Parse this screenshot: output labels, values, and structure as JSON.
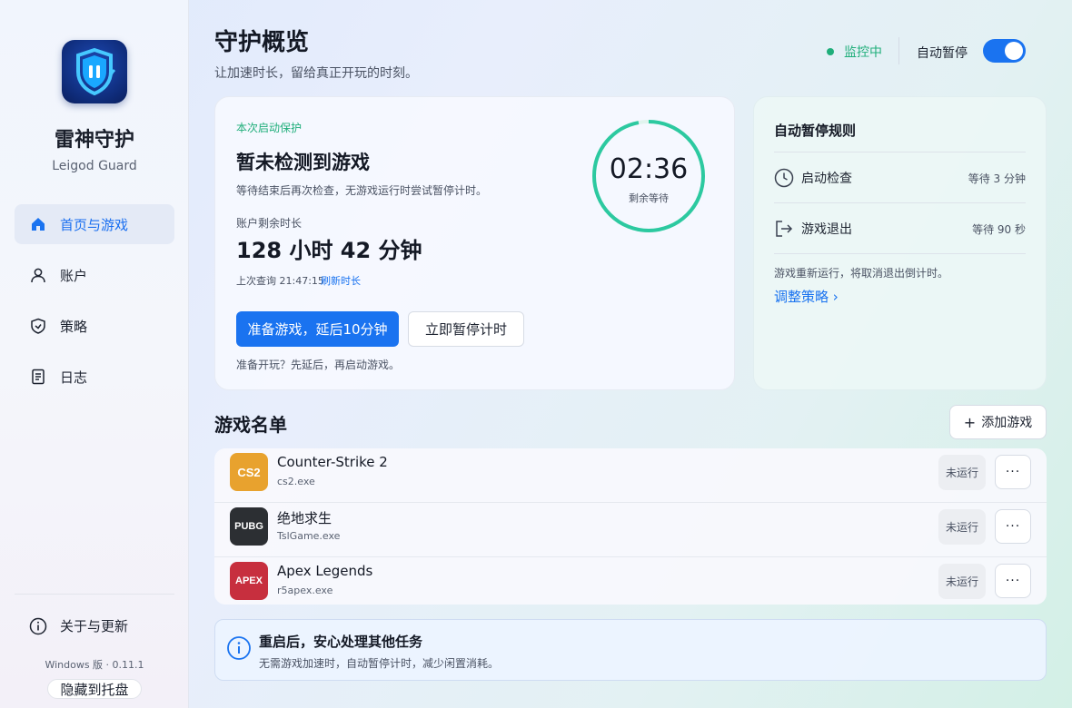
{
  "brand": {
    "name": "雷神守护",
    "sub": "Leigod Guard"
  },
  "nav": [
    {
      "label": "首页与游戏",
      "icon": "home-icon",
      "active": true
    },
    {
      "label": "账户",
      "icon": "user-icon"
    },
    {
      "label": "策略",
      "icon": "shield-icon"
    },
    {
      "label": "日志",
      "icon": "document-icon"
    }
  ],
  "sidebar_footer": {
    "about": "关于与更新",
    "version": "Windows 版 · 0.11.1",
    "tray_button": "隐藏到托盘"
  },
  "header": {
    "title": "守护概览",
    "subtitle": "让加速时长，留给真正开玩的时刻。",
    "status": "监控中",
    "auto_pause_label": "自动暂停",
    "auto_pause_on": true
  },
  "session": {
    "tag": "本次启动保护",
    "title": "暂未检测到游戏",
    "desc": "等待结束后再次检查，无游戏运行时尝试暂停计时。",
    "remaining_label": "账户剩余时长",
    "remaining_value": "128 小时 42 分钟",
    "last_query": "上次查询 21:47:15",
    "refresh": "刷新时长",
    "primary_button": "准备游戏，延后10分钟",
    "secondary_button": "立即暂停计时",
    "hint": "准备开玩？先延后，再启动游戏。",
    "timer": {
      "time": "02:36",
      "label": "剩余等待",
      "progress": 0.97
    }
  },
  "rules": {
    "title": "自动暂停规则",
    "items": [
      {
        "name": "启动检查",
        "value": "等待 3 分钟",
        "icon": "clock-icon"
      },
      {
        "name": "游戏退出",
        "value": "等待 90 秒",
        "icon": "exit-icon"
      }
    ],
    "note": "游戏重新运行，将取消退出倒计时。",
    "link": "调整策略 ›"
  },
  "games": {
    "title": "游戏名单",
    "add_button": "添加游戏",
    "items": [
      {
        "name": "Counter-Strike 2",
        "exe": "cs2.exe",
        "status": "未运行",
        "badge": "CS2",
        "color": "#e8a22e"
      },
      {
        "name": "绝地求生",
        "exe": "TslGame.exe",
        "status": "未运行",
        "badge": "PUBG",
        "color": "#2c2f33"
      },
      {
        "name": "Apex Legends",
        "exe": "r5apex.exe",
        "status": "未运行",
        "badge": "APEX",
        "color": "#c72f3e"
      }
    ],
    "more_label": "···"
  },
  "info": {
    "title": "重启后，安心处理其他任务",
    "desc": "无需游戏加速时，自动暂停计时，减少闲置消耗。"
  },
  "colors": {
    "accent": "#1a73f0",
    "success": "#1fae7a",
    "timer_ring": "#2cc9a0"
  }
}
